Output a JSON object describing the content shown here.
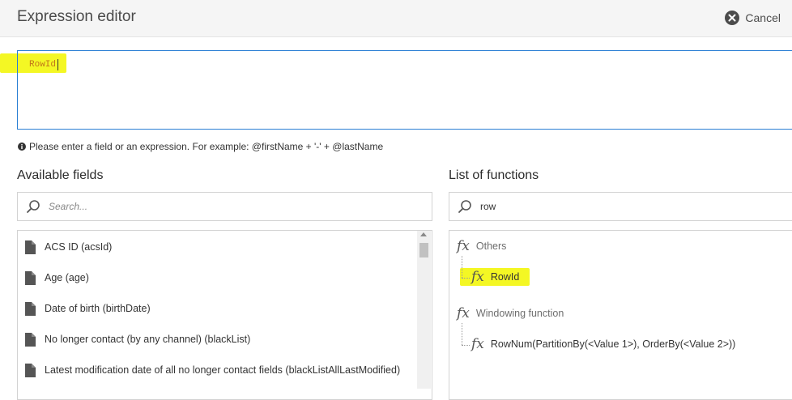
{
  "header": {
    "title": "Expression editor",
    "cancel_label": "Cancel"
  },
  "expression": {
    "value": "RowId"
  },
  "hint": {
    "text": "Please enter a field or an expression. For example: @firstName + '-' + @lastName"
  },
  "available_fields": {
    "label": "Available fields",
    "search_placeholder": "Search...",
    "items": [
      {
        "label": "ACS ID (acsId)"
      },
      {
        "label": "Age (age)"
      },
      {
        "label": "Date of birth (birthDate)"
      },
      {
        "label": "No longer contact (by any channel) (blackList)"
      },
      {
        "label": "Latest modification date of all no longer contact fields (blackListAllLastModified)"
      }
    ]
  },
  "functions": {
    "label": "List of functions",
    "search_value": "row",
    "groups": [
      {
        "name": "Others",
        "items": [
          {
            "label": "RowId"
          }
        ]
      },
      {
        "name": "Windowing function",
        "items": [
          {
            "label": "RowNum(PartitionBy(<Value 1>), OrderBy(<Value 2>))"
          }
        ]
      }
    ]
  },
  "colors": {
    "highlight": "#f4f724",
    "focus_border": "#2a7fd4",
    "expression_text": "#c1761a"
  },
  "icons": {
    "cancel": "close-circle-icon",
    "info": "info-icon",
    "search": "search-icon",
    "field": "document-icon",
    "function": "fx-icon"
  }
}
